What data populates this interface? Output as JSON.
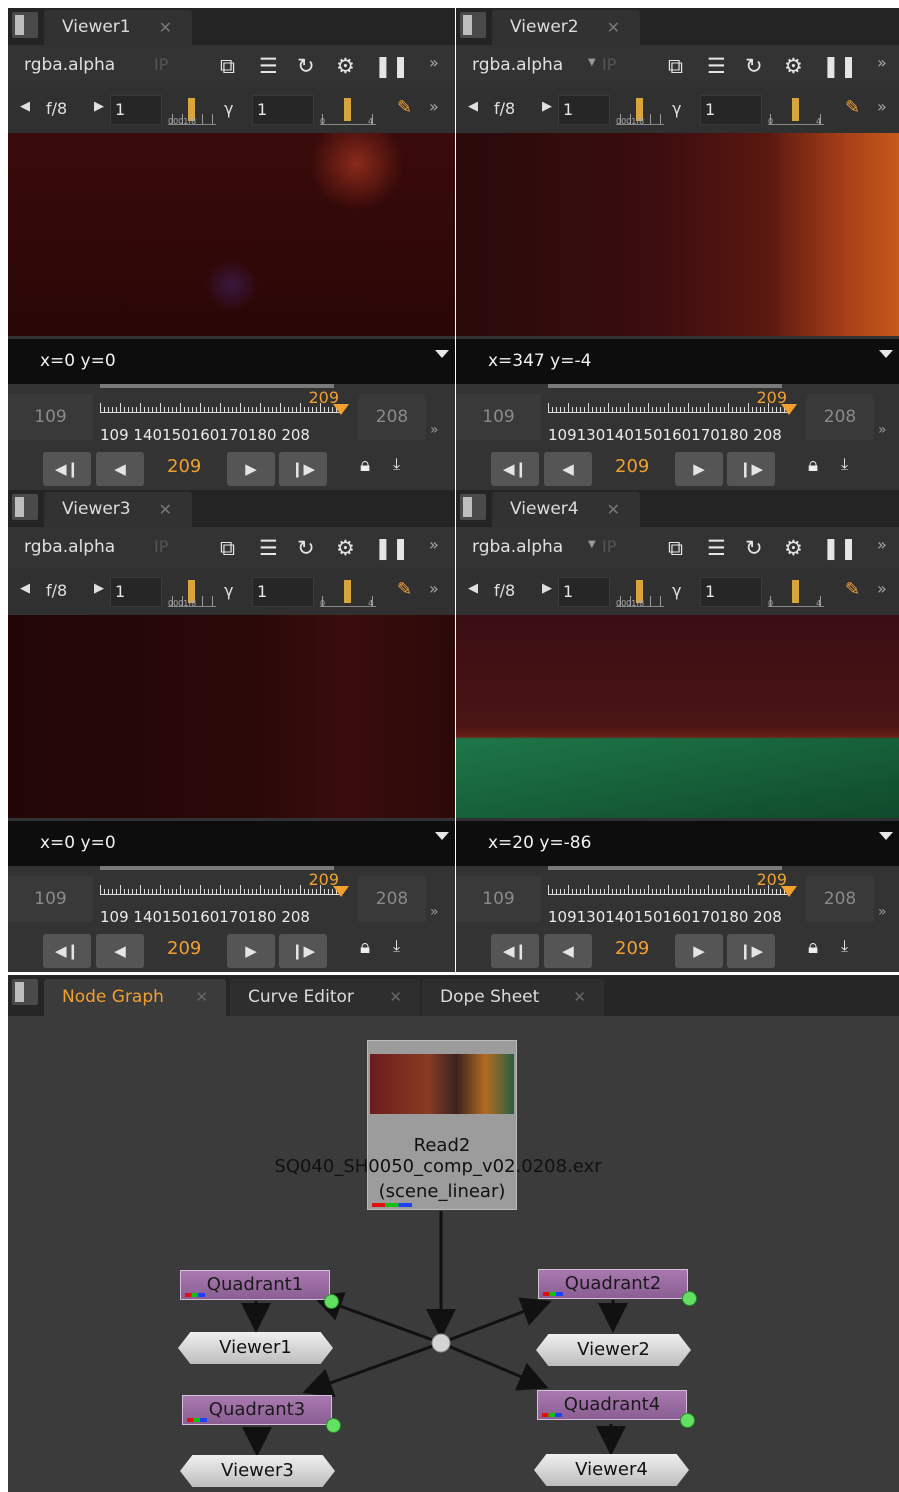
{
  "viewers": [
    {
      "tab": "Viewer1",
      "close": "✕",
      "channel": "rgba.alpha",
      "ip": "IP",
      "fstop": "f/8",
      "gain": "1",
      "gamma_label": "γ",
      "gamma": "1",
      "gain_ticks": "0001f8",
      "gamma_ticks_lo": "0",
      "gamma_ticks_hi": "4",
      "coords": "x=0 y=0",
      "in_frame": "109",
      "out_frame": "208",
      "end_frame": "209",
      "ruler_labels": "109   140150160170180  208",
      "current_frame": "209",
      "has_dropdown": false
    },
    {
      "tab": "Viewer2",
      "close": "✕",
      "channel": "rgba.alpha",
      "ip": "IP",
      "fstop": "f/8",
      "gain": "1",
      "gamma_label": "γ",
      "gamma": "1",
      "gain_ticks": "0001f8",
      "gamma_ticks_lo": "0",
      "gamma_ticks_hi": "4",
      "coords": "x=347 y=-4",
      "in_frame": "109",
      "out_frame": "208",
      "end_frame": "209",
      "ruler_labels": "109130140150160170180  208",
      "current_frame": "209",
      "has_dropdown": true
    },
    {
      "tab": "Viewer3",
      "close": "✕",
      "channel": "rgba.alpha",
      "ip": "IP",
      "fstop": "f/8",
      "gain": "1",
      "gamma_label": "γ",
      "gamma": "1",
      "gain_ticks": "0001f8",
      "gamma_ticks_lo": "0",
      "gamma_ticks_hi": "4",
      "coords": "x=0 y=0",
      "in_frame": "109",
      "out_frame": "208",
      "end_frame": "209",
      "ruler_labels": "109   140150160170180  208",
      "current_frame": "209",
      "has_dropdown": false
    },
    {
      "tab": "Viewer4",
      "close": "✕",
      "channel": "rgba.alpha",
      "ip": "IP",
      "fstop": "f/8",
      "gain": "1",
      "gamma_label": "γ",
      "gamma": "1",
      "gain_ticks": "0001f8",
      "gamma_ticks_lo": "0",
      "gamma_ticks_hi": "4",
      "coords": "x=20 y=-86",
      "in_frame": "109",
      "out_frame": "208",
      "end_frame": "209",
      "ruler_labels": "109130140150160170180  208",
      "current_frame": "209",
      "has_dropdown": true
    }
  ],
  "node_graph": {
    "tabs": [
      {
        "label": "Node Graph",
        "close": "✕",
        "active": true
      },
      {
        "label": "Curve Editor",
        "close": "✕",
        "active": false
      },
      {
        "label": "Dope Sheet",
        "close": "✕",
        "active": false
      }
    ],
    "read_node": {
      "name": "Read2",
      "file": "SQ040_SH0050_comp_v02.0208.exr",
      "colorspace": "(scene_linear)"
    },
    "quadrants": [
      "Quadrant1",
      "Quadrant2",
      "Quadrant3",
      "Quadrant4"
    ],
    "viewer_nodes": [
      "Viewer1",
      "Viewer2",
      "Viewer3",
      "Viewer4"
    ]
  },
  "colors": {
    "accent": "#f0a030",
    "panel": "#323232",
    "node_graph_bg": "#3b3b3b",
    "quadrant_node": "#9a6aa3"
  }
}
